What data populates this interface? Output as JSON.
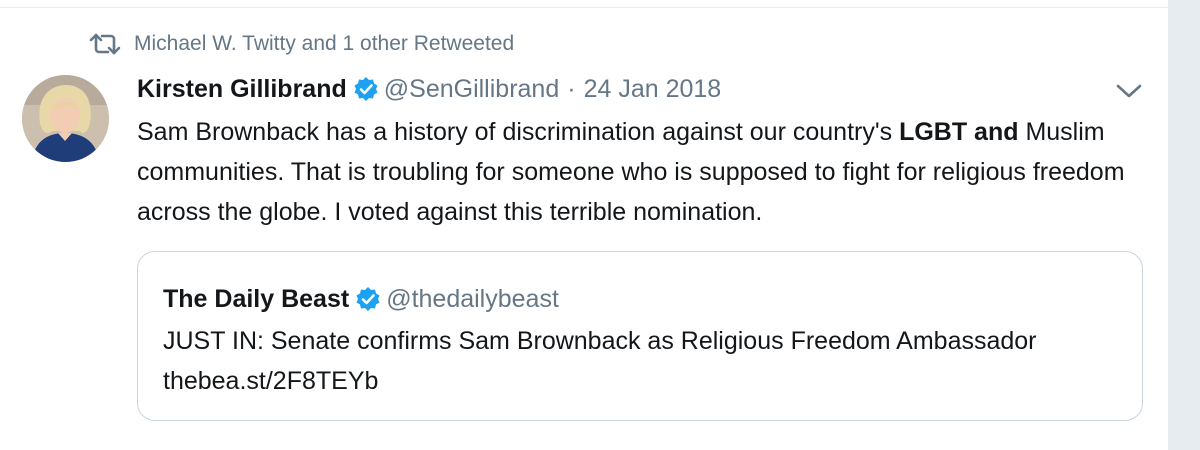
{
  "retweet_context": {
    "icon": "retweet-icon",
    "text": "Michael W. Twitty and 1 other Retweeted"
  },
  "tweet": {
    "avatar_alt": "avatar",
    "author_name": "Kirsten Gillibrand",
    "verified_icon": "verified-badge-icon",
    "handle": "@SenGillibrand",
    "separator": "·",
    "date": "24 Jan 2018",
    "menu_icon": "chevron-down-icon",
    "text_part1": "Sam Brownback has a history of discrimination against our country's ",
    "text_bold": "LGBT and",
    "text_part2": " Muslim communities. That is troubling for someone who is supposed to fight for religious freedom across the globe. I voted against this terrible nomination."
  },
  "quote": {
    "author_name": "The Daily Beast",
    "verified_icon": "verified-badge-icon",
    "handle": "@thedailybeast",
    "text": "JUST IN: Senate confirms Sam Brownback as Religious Freedom Ambassador thebea.st/2F8TEYb"
  },
  "colors": {
    "primary_text": "#14171a",
    "secondary_text": "#657786",
    "verified_blue": "#1da1f2",
    "border": "#ccd6dd",
    "gutter": "#e6ecf0"
  }
}
